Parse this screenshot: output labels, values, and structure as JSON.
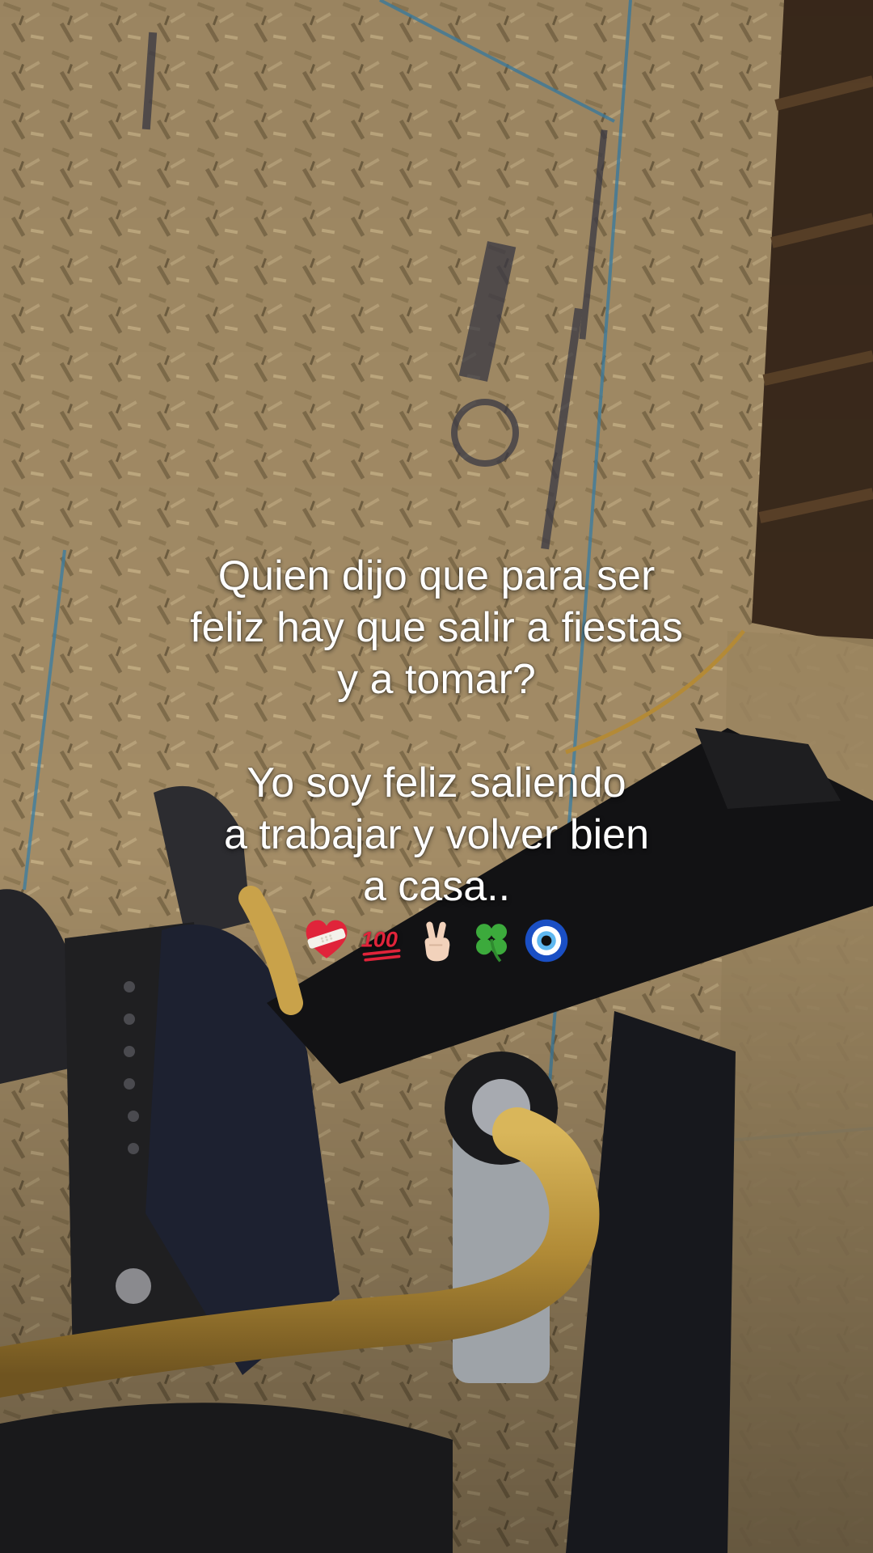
{
  "caption": {
    "line1": "Quien dijo que para ser",
    "line2": "feliz hay que salir a fiestas",
    "line3": "y a tomar?",
    "line4": "Yo soy feliz saliendo",
    "line5": "a trabajar y volver bien",
    "line6": "a casa.."
  },
  "emojis": [
    "heart-with-bandage-icon",
    "hundred-points-icon",
    "victory-hand-icon",
    "four-leaf-clover-icon",
    "nazar-amulet-icon"
  ],
  "colors": {
    "caption_text": "#ffffff",
    "osb_board": "#a8916a",
    "hose": "#c9a24a"
  }
}
